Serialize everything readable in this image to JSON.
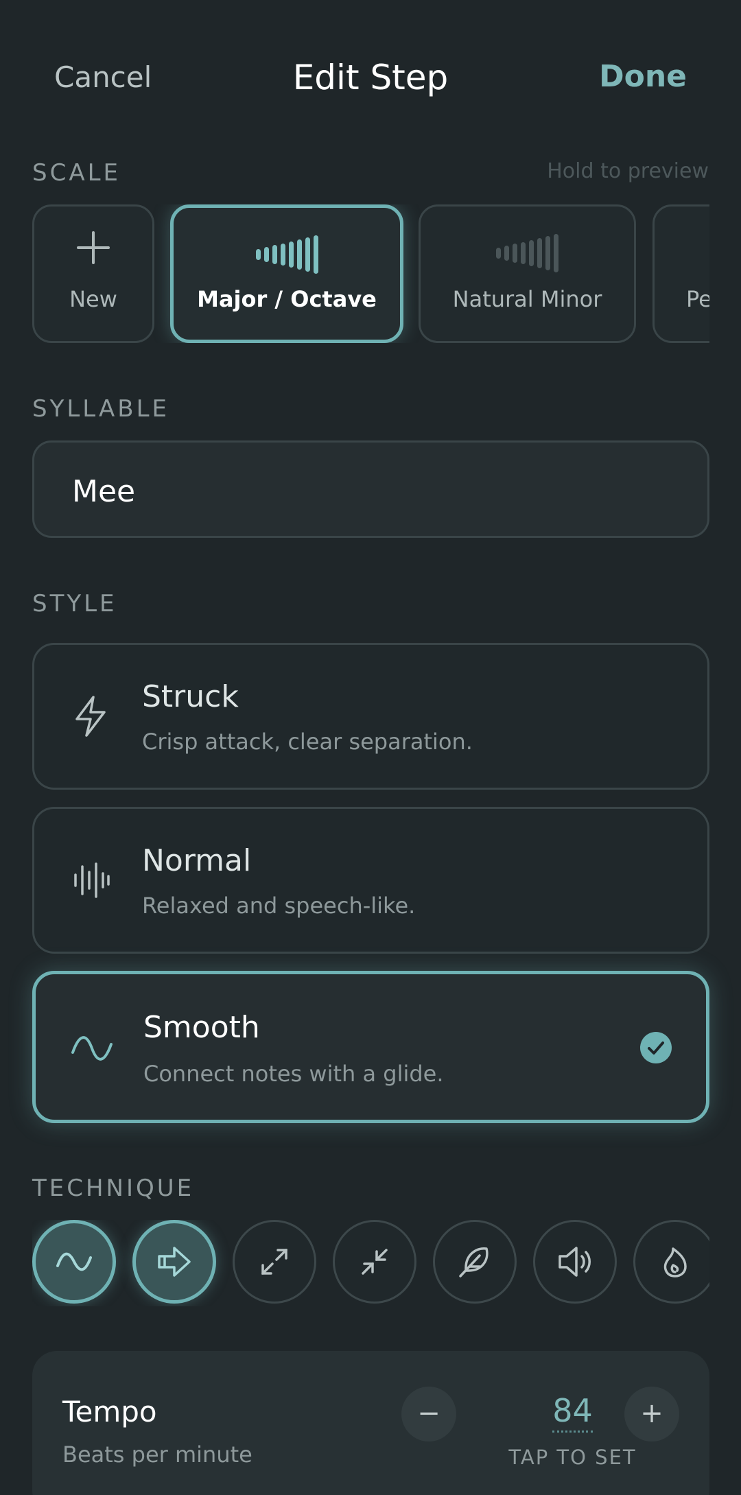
{
  "header": {
    "cancel_label": "Cancel",
    "title": "Edit Step",
    "done_label": "Done"
  },
  "scale": {
    "section_label": "SCALE",
    "hint": "Hold to preview",
    "new_label": "New",
    "items": [
      {
        "label": "Major / Octave",
        "selected": true
      },
      {
        "label": "Natural Minor",
        "selected": false
      },
      {
        "label": "Pe",
        "selected": false
      }
    ]
  },
  "syllable": {
    "section_label": "SYLLABLE",
    "value": "Mee"
  },
  "style": {
    "section_label": "STYLE",
    "options": [
      {
        "title": "Struck",
        "description": "Crisp attack, clear separation.",
        "icon": "lightning-icon",
        "selected": false
      },
      {
        "title": "Normal",
        "description": "Relaxed and speech-like.",
        "icon": "waveform-icon",
        "selected": false
      },
      {
        "title": "Smooth",
        "description": "Connect notes with a glide.",
        "icon": "sine-wave-icon",
        "selected": true
      }
    ]
  },
  "technique": {
    "section_label": "TECHNIQUE",
    "buttons": [
      {
        "icon": "sine-wave-icon",
        "active": true
      },
      {
        "icon": "arrow-right-icon",
        "active": true
      },
      {
        "icon": "expand-icon",
        "active": false
      },
      {
        "icon": "collapse-icon",
        "active": false
      },
      {
        "icon": "feather-icon",
        "active": false
      },
      {
        "icon": "speaker-icon",
        "active": false
      },
      {
        "icon": "flame-icon",
        "active": false
      }
    ]
  },
  "tempo": {
    "title": "Tempo",
    "subtitle": "Beats per minute",
    "value": "84",
    "minus_label": "−",
    "plus_label": "+",
    "tap_label": "TAP TO SET"
  },
  "colors": {
    "background": "#1f2629",
    "accent": "#6fb2b4",
    "card_border": "#3a4548"
  }
}
